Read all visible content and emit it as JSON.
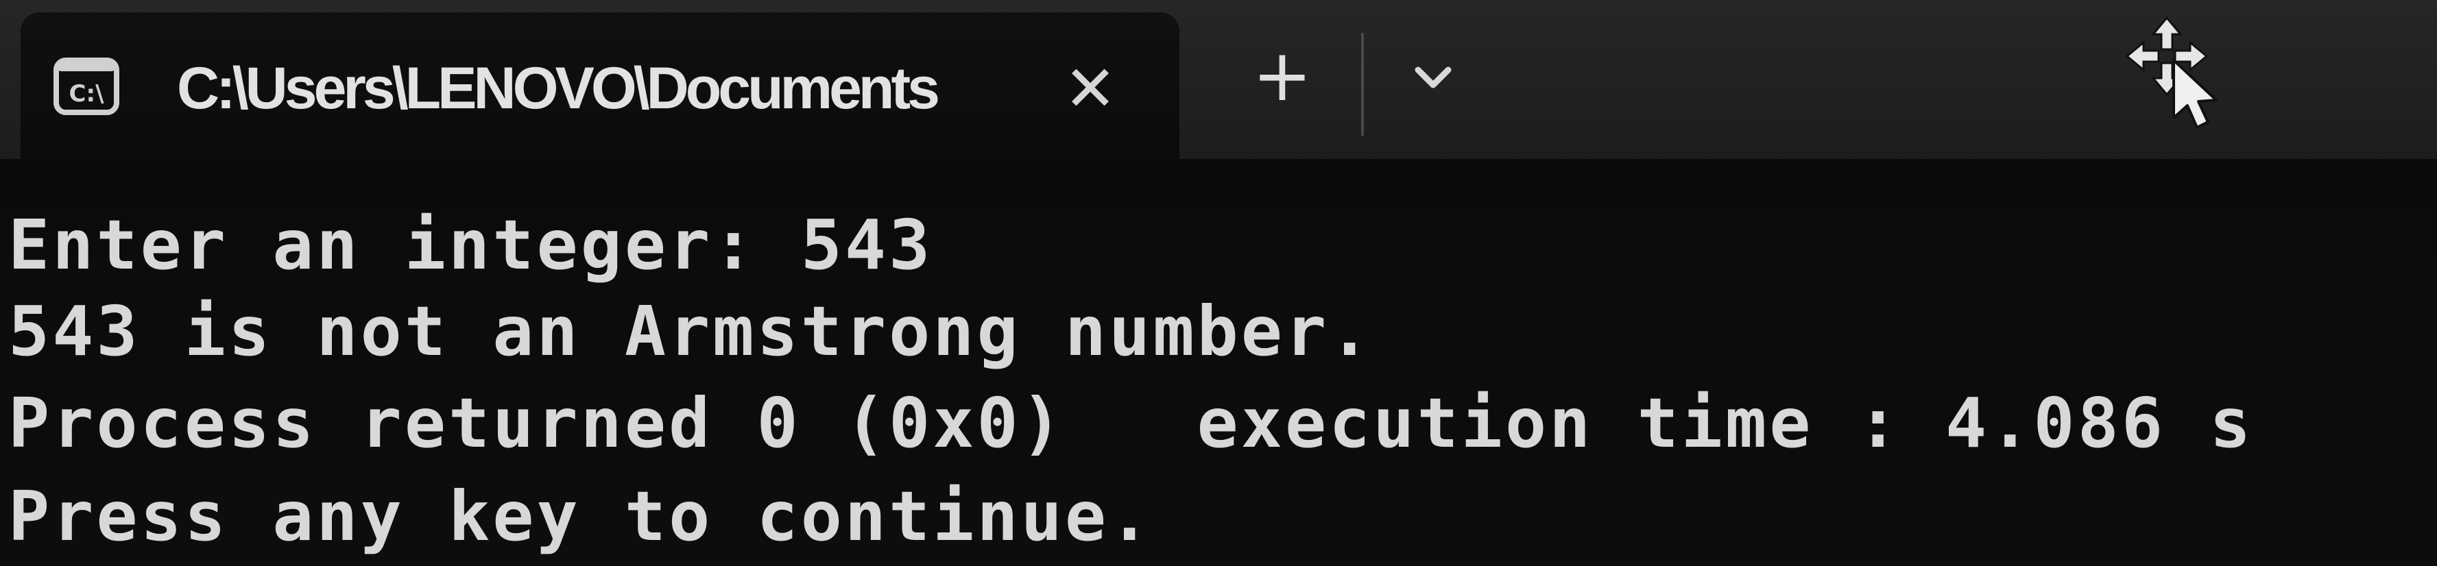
{
  "tab": {
    "icon": "console-icon",
    "title": "C:\\Users\\LENOVO\\Documents",
    "close_icon": "close-icon"
  },
  "tabbar": {
    "new_tab_icon": "plus-icon",
    "dropdown_icon": "chevron-down-icon"
  },
  "cursor": {
    "icon": "move-cursor-icon"
  },
  "console": {
    "lines": [
      "Enter an integer: 543",
      "543 is not an Armstrong number.",
      "Process returned 0 (0x0)   execution time : 4.086 s",
      "Press any key to continue."
    ]
  },
  "colors": {
    "background": "#0b0b0b",
    "titlebar": "#1f1f1f",
    "text": "#d8d8d8"
  }
}
